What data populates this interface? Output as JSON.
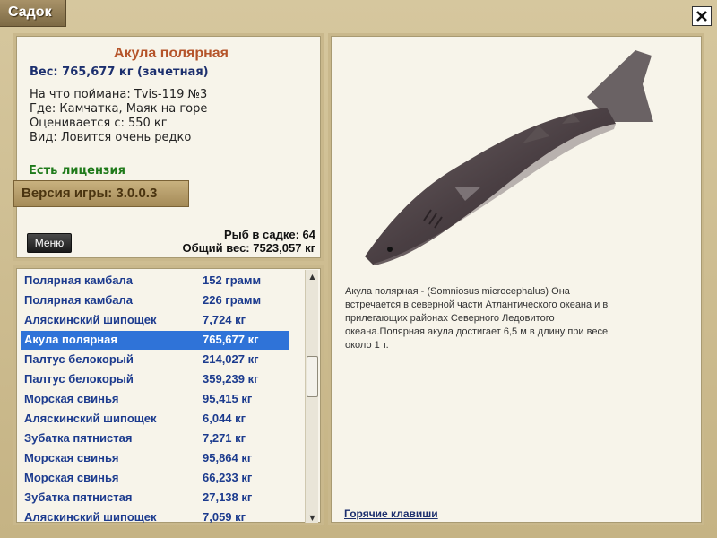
{
  "window": {
    "title": "Садок"
  },
  "info": {
    "fish_name": "Акула полярная",
    "weight_line": "Вес: 765,677 кг (зачетная)",
    "caught_with": "На что поймана: Tvis-119 №3",
    "where": "Где: Камчатка, Маяк на горе",
    "valued_from": "Оценивается с: 550 кг",
    "species_rarity": "Вид: Ловится очень редко",
    "license": "Есть лицензия",
    "version": "Версия игры: 3.0.0.3",
    "menu_label": "Меню",
    "fish_count": "Рыб в садке: 64",
    "total_weight": "Общий вес: 7523,057 кг"
  },
  "fish_list": [
    {
      "name": "Полярная камбала",
      "weight": "152 грамм",
      "selected": false
    },
    {
      "name": "Полярная камбала",
      "weight": "226 грамм",
      "selected": false
    },
    {
      "name": "Аляскинский шипощек",
      "weight": "7,724 кг",
      "selected": false
    },
    {
      "name": "Акула полярная",
      "weight": "765,677 кг",
      "selected": true
    },
    {
      "name": "Палтус белокорый",
      "weight": "214,027 кг",
      "selected": false
    },
    {
      "name": "Палтус белокорый",
      "weight": "359,239 кг",
      "selected": false
    },
    {
      "name": "Морская свинья",
      "weight": "95,415 кг",
      "selected": false
    },
    {
      "name": "Аляскинский шипощек",
      "weight": "6,044 кг",
      "selected": false
    },
    {
      "name": "Зубатка пятнистая",
      "weight": "7,271 кг",
      "selected": false
    },
    {
      "name": "Морская свинья",
      "weight": "95,864 кг",
      "selected": false
    },
    {
      "name": "Морская свинья",
      "weight": "66,233 кг",
      "selected": false
    },
    {
      "name": "Зубатка пятнистая",
      "weight": "27,138 кг",
      "selected": false
    },
    {
      "name": "Аляскинский шипощек",
      "weight": "7,059 кг",
      "selected": false
    }
  ],
  "description": {
    "line1": "Акула полярная - (Somniosus microcephalus) Она",
    "line2": "встречается в северной части Атлантического океана и в",
    "line3": "прилегающих районах Северного Ледовитого",
    "line4": "океана.Полярная акула достигает 6,5 м в длину при весе",
    "line5": "около 1 т."
  },
  "hotkeys_label": "Горячие клавиши",
  "colors": {
    "selected_row": "#2f73d8",
    "title_accent": "#b5542a",
    "list_text": "#1c3b8e"
  },
  "icons": {
    "close": "close-icon",
    "scroll_up": "scroll-up-arrow-icon",
    "scroll_down": "scroll-down-arrow-icon"
  }
}
